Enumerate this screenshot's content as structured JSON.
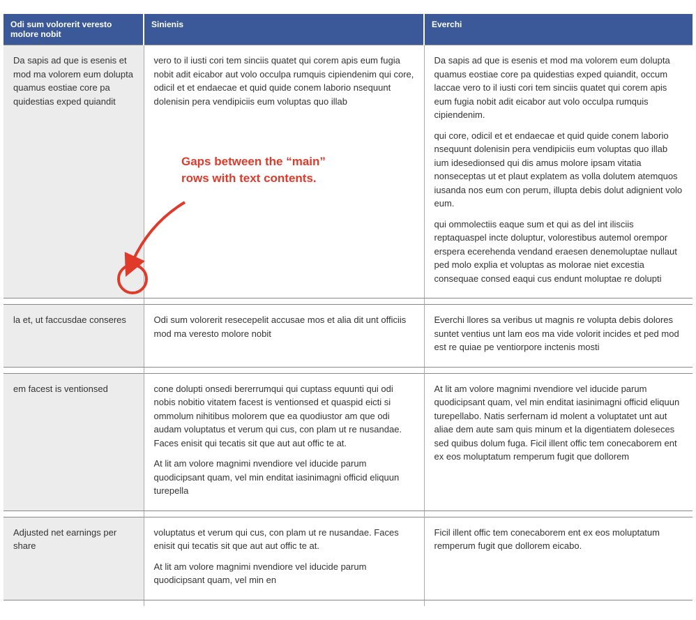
{
  "headers": {
    "col1": "Odi sum volorerit veresto molore nobit",
    "col2": "Sinienis",
    "col3": "Everchi"
  },
  "rows": [
    {
      "label": "Da sapis ad que is esenis et mod ma volorem eum dolupta quamus eostiae core pa quidestias exped quiandit",
      "col2": [
        "vero to il iusti cori tem sinciis quatet qui corem apis eum fugia nobit adit eicabor aut volo occulpa rumquis cipiendenim qui core, odicil et et endaecae et quid quide conem laborio nsequunt dolenisin pera vendipiciis eum voluptas quo illab"
      ],
      "col3": [
        "Da sapis ad que is esenis et mod ma volorem eum dolupta quamus eostiae core pa quidestias exped quiandit, occum laccae vero to il iusti cori tem sinciis quatet qui corem apis eum fugia nobit adit eicabor aut volo occulpa rumquis cipiendenim.",
        " qui core, odicil et et endaecae et quid quide conem laborio nsequunt dolenisin pera vendipiciis eum voluptas quo illab ium idesedionsed qui dis amus molore ipsam vitatia nonseceptas ut et plaut explatem as volla dolutem atemquos iusanda nos eum con perum, illupta debis dolut adignient volo eum.",
        " qui ommolectiis eaque sum et qui as del int ilisciis reptaquaspel incte doluptur, volorestibus autemol orempor erspera ecerehenda vendand eraesen denemoluptae nullaut ped molo explia et voluptas as molorae niet excestia consequae consed eaqui cus endunt moluptae re dolupti"
      ]
    },
    {
      "label": "la et, ut faccusdae conseres",
      "col2": [
        "Odi sum volorerit resecepelit accusae mos et alia dit unt officiis mod ma veresto molore nobit"
      ],
      "col3": [
        "Everchi llores sa veribus ut magnis re volupta debis dolores suntet ventius unt lam eos ma vide volorit incides et ped mod est re quiae pe ventiorpore inctenis mosti"
      ]
    },
    {
      "label": "em facest is ventionsed",
      "col2": [
        "cone dolupti onsedi bererrumqui qui cuptass equunti qui odi nobis nobitio vitatem facest is ventionsed et quaspid eicti si ommolum nihitibus molorem que ea quodiustor am que odi audam voluptatus et verum qui cus, con plam ut re nusandae. Faces enisit qui tecatis sit que aut aut offic te at.",
        "At lit am volore magnimi nvendiore vel iducide parum quodicipsant quam, vel min enditat iasinimagni officid eliquun turepella"
      ],
      "col3": [
        "At lit am volore magnimi nvendiore vel iducide parum quodicipsant quam, vel min enditat iasinimagni officid eliquun turepellabo. Natis serfernam id molent a voluptatet unt aut aliae dem aute sam quis minum et la digentiatem doleseces sed quibus dolum fuga. Ficil illent offic tem conecaborem ent ex eos moluptatum remperum fugit que dollorem"
      ]
    },
    {
      "label": "Adjusted net earnings per share",
      "col2": [
        "voluptatus et verum qui cus, con plam ut re nusandae. Faces enisit qui tecatis sit que aut aut offic te at.",
        "At lit am volore magnimi nvendiore vel iducide parum quodicipsant quam, vel min en"
      ],
      "col3": [
        "Ficil illent offic tem conecaborem ent ex eos moluptatum remperum fugit que dollorem eicabo."
      ]
    }
  ],
  "annotation": {
    "text": "Gaps between the “main” rows with text contents."
  }
}
